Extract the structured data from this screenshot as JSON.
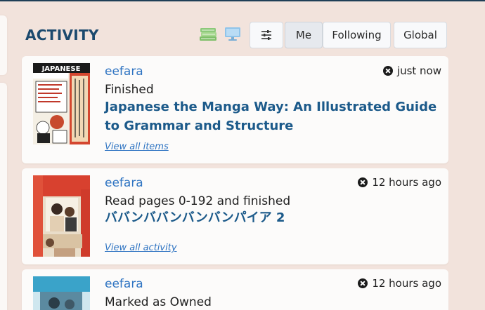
{
  "heading": "ACTIVITY",
  "filters": {
    "me": "Me",
    "following": "Following",
    "global": "Global"
  },
  "icons": {
    "books": "books-stack-icon",
    "monitor": "monitor-icon",
    "settings": "sliders-icon",
    "remove": "close-circle-icon"
  },
  "activities": [
    {
      "user": "eefara",
      "time": "just now",
      "action": "Finished",
      "title": "Japanese the Manga Way: An Illustrated Guide to Grammar and Structure",
      "link": "View all items"
    },
    {
      "user": "eefara",
      "time": "12 hours ago",
      "action": "Read pages 0-192 and finished",
      "title": "ババンババンバンバンパイア 2",
      "link": "View all activity"
    },
    {
      "user": "eefara",
      "time": "12 hours ago",
      "action": "Marked as Owned"
    }
  ],
  "colors": {
    "background": "#f2e3dc",
    "heading": "#1c4a6e",
    "link": "#2f74c2",
    "title": "#1c5a8a"
  }
}
